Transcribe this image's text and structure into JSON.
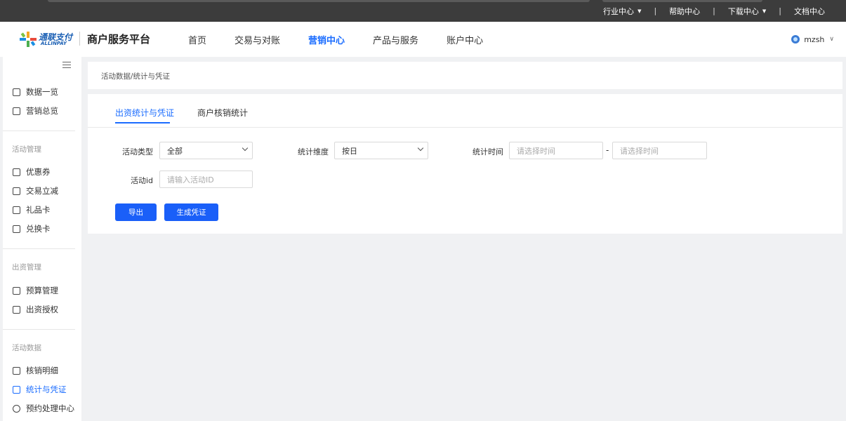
{
  "topbar": {
    "links": [
      {
        "label": "行业中心",
        "has_caret": true
      },
      {
        "label": "帮助中心",
        "has_caret": false
      },
      {
        "label": "下载中心",
        "has_caret": true
      },
      {
        "label": "文档中心",
        "has_caret": false
      }
    ],
    "separator": "|"
  },
  "header": {
    "logo_cn": "通联支付",
    "logo_en": "ALLINPAY",
    "platform_title": "商户服务平台",
    "nav": [
      "首页",
      "交易与对账",
      "营销中心",
      "产品与服务",
      "账户中心"
    ],
    "active_nav": "营销中心",
    "username": "mzsh",
    "colors": {
      "accent": "#1a6cff"
    }
  },
  "sidebar": {
    "top_items": [
      {
        "label": "数据一览",
        "icon": "chart-icon"
      },
      {
        "label": "营销总览",
        "icon": "chart-icon"
      }
    ],
    "groups": [
      {
        "title": "活动管理",
        "items": [
          {
            "label": "优惠券",
            "icon": "coupon-icon"
          },
          {
            "label": "交易立减",
            "icon": "discount-icon"
          },
          {
            "label": "礼品卡",
            "icon": "card-icon"
          },
          {
            "label": "兑换卡",
            "icon": "exchange-icon"
          }
        ]
      },
      {
        "title": "出资管理",
        "items": [
          {
            "label": "预算管理",
            "icon": "budget-icon"
          },
          {
            "label": "出资授权",
            "icon": "document-icon"
          }
        ]
      },
      {
        "title": "活动数据",
        "items": [
          {
            "label": "核销明细",
            "icon": "detail-icon"
          },
          {
            "label": "统计与凭证",
            "icon": "stats-icon",
            "active": true
          },
          {
            "label": "预约处理中心",
            "icon": "clock-icon"
          }
        ]
      }
    ]
  },
  "breadcrumb": "活动数据/统计与凭证",
  "tabs": [
    {
      "label": "出资统计与凭证",
      "active": true
    },
    {
      "label": "商户核销统计",
      "active": false
    }
  ],
  "form": {
    "activity_type": {
      "label": "活动类型",
      "value": "全部"
    },
    "dimension": {
      "label": "统计维度",
      "value": "按日"
    },
    "time": {
      "label": "统计时间",
      "start_placeholder": "请选择时间",
      "end_placeholder": "请选择时间",
      "separator": "-"
    },
    "activity_id": {
      "label": "活动id",
      "placeholder": "请输入活动ID"
    }
  },
  "buttons": {
    "export": "导出",
    "generate": "生成凭证"
  }
}
